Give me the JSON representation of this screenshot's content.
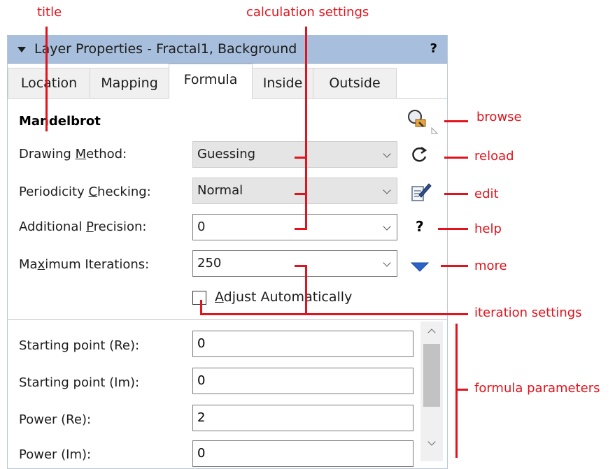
{
  "annotations": {
    "title": "title",
    "calculation_settings": "calculation settings",
    "browse": "browse",
    "reload": "reload",
    "edit": "edit",
    "help": "help",
    "more": "more",
    "iteration_settings": "iteration settings",
    "formula_parameters": "formula parameters"
  },
  "panel": {
    "title": "Layer Properties - Fractal1, Background",
    "help_glyph": "?"
  },
  "tabs": [
    "Location",
    "Mapping",
    "Formula",
    "Inside",
    "Outside"
  ],
  "active_tab": "Formula",
  "formula": {
    "name": "Mandelbrot",
    "drawing_method": {
      "label_pre": "Drawing ",
      "label_ul": "M",
      "label_post": "ethod:",
      "value": "Guessing"
    },
    "periodicity": {
      "label_pre": "Periodicity ",
      "label_ul": "C",
      "label_post": "hecking:",
      "value": "Normal"
    },
    "precision": {
      "label_pre": "Additional ",
      "label_ul": "P",
      "label_post": "recision:",
      "value": "0"
    },
    "iterations": {
      "label_pre": "Ma",
      "label_ul": "x",
      "label_post": "imum Iterations:",
      "value": "250"
    },
    "adjust": {
      "label_pre": "",
      "label_ul": "A",
      "label_post": "djust Automatically",
      "checked": false
    }
  },
  "parameters": [
    {
      "label": "Starting point (Re):",
      "value": "0"
    },
    {
      "label": "Starting point (Im):",
      "value": "0"
    },
    {
      "label": "Power (Re):",
      "value": "2"
    },
    {
      "label": "Power (Im):",
      "value": "0"
    }
  ],
  "icons": {
    "browse": "magnifier-browse-icon",
    "reload": "reload-icon",
    "edit": "edit-icon",
    "help": "?",
    "more": "more-icon"
  },
  "colors": {
    "annotation": "#e2131c",
    "titlebar": "#a7bfdc",
    "more_triangle": "#2d63c8"
  }
}
